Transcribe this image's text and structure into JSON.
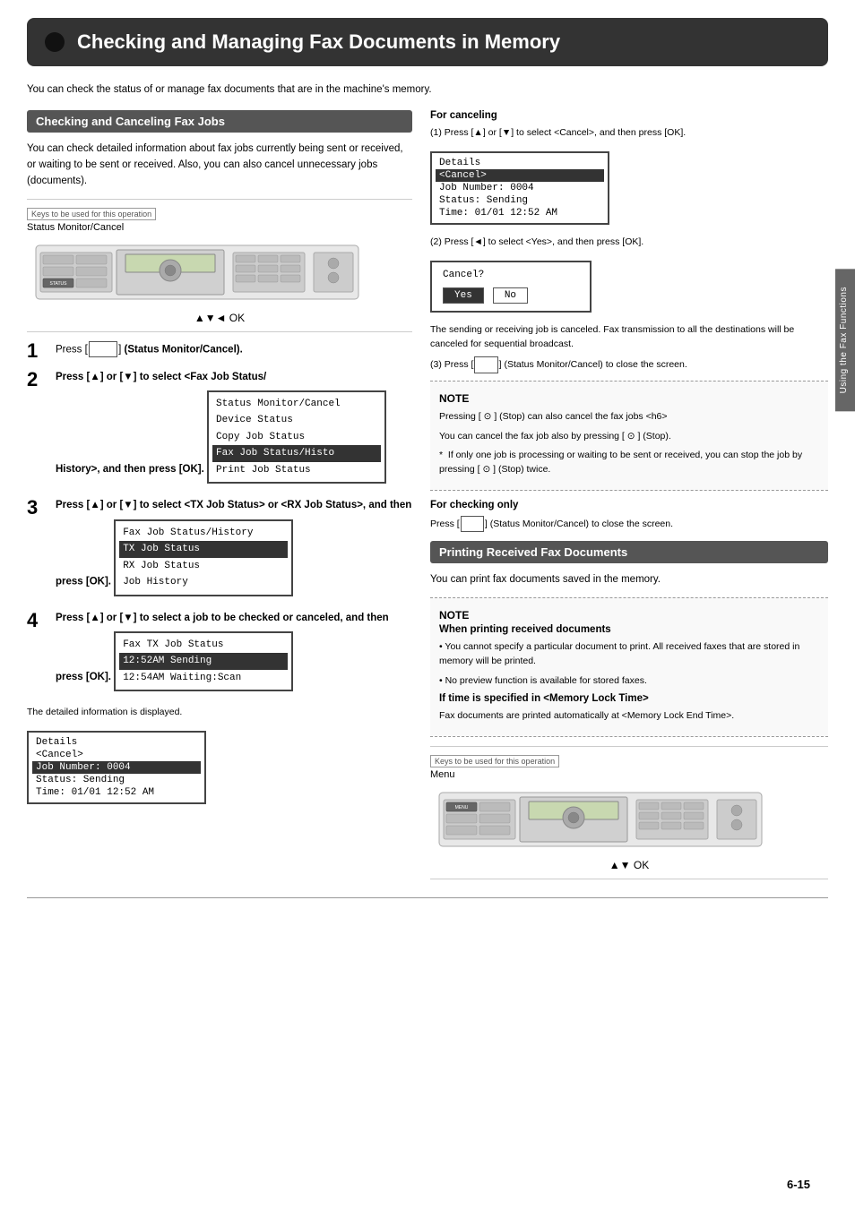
{
  "title": "Checking and Managing Fax Documents in Memory",
  "intro": "You can check the status of or manage fax documents that are in the machine's memory.",
  "left_section": {
    "header": "Checking and Canceling Fax Jobs",
    "description": "You can check detailed information about fax jobs currently being sent or received, or waiting to be sent or received. Also, you can also cancel unnecessary jobs (documents).",
    "keys_label": "Keys to be used for this operation",
    "machine_label": "Status Monitor/Cancel",
    "arrow_row": "▲▼◄ OK",
    "steps": [
      {
        "number": "1",
        "text": "Press [",
        "button_label": "",
        "text_after": " ] (Status Monitor/Cancel)."
      },
      {
        "number": "2",
        "text": "Press [▲] or [▼] to select <Fax Job Status/History>, and then press [OK]."
      },
      {
        "number": "3",
        "text": "Press [▲] or [▼] to select <TX Job Status> or <RX Job Status>, and then press [OK]."
      },
      {
        "number": "4",
        "text": "Press [▲] or [▼] to select a job to be checked or canceled, and then press [OK]."
      }
    ],
    "lcd1": {
      "rows": [
        {
          "text": "Status Monitor/Cancel",
          "highlighted": false
        },
        {
          "text": "Device Status",
          "highlighted": false
        },
        {
          "text": "Copy Job Status",
          "highlighted": false
        },
        {
          "text": "Fax Job Status/Histo",
          "highlighted": true
        },
        {
          "text": "Print Job Status",
          "highlighted": false
        }
      ]
    },
    "lcd2": {
      "rows": [
        {
          "text": "Fax Job Status/History",
          "highlighted": false
        },
        {
          "text": "TX Job Status",
          "highlighted": true
        },
        {
          "text": "RX Job Status",
          "highlighted": false
        },
        {
          "text": "Job History",
          "highlighted": false
        }
      ]
    },
    "lcd3": {
      "rows": [
        {
          "text": "Fax TX Job Status",
          "highlighted": false
        },
        {
          "text": "12:52AM Sending",
          "highlighted": true
        },
        {
          "text": "12:54AM Waiting:Scan",
          "highlighted": false
        }
      ]
    },
    "detailed_info_label": "The detailed information is displayed.",
    "lcd4": {
      "rows": [
        {
          "text": "Details",
          "highlighted": false
        },
        {
          "text": "<Cancel>",
          "highlighted": false
        },
        {
          "text": "Job Number: 0004",
          "highlighted": true
        },
        {
          "text": "Status: Sending",
          "highlighted": false
        },
        {
          "text": "Time: 01/01 12:52 AM",
          "highlighted": false
        }
      ]
    }
  },
  "right_section": {
    "for_canceling_header": "For canceling",
    "for_canceling_step1": "(1) Press [▲] or [▼] to select <Cancel>, and then press [OK].",
    "details_lcd": {
      "rows": [
        {
          "text": "Details",
          "highlighted": false
        },
        {
          "text": "<Cancel>",
          "highlighted": true
        },
        {
          "text": "Job Number: 0004",
          "highlighted": false
        },
        {
          "text": "Status: Sending",
          "highlighted": false
        },
        {
          "text": "Time: 01/01 12:52 AM",
          "highlighted": false
        }
      ]
    },
    "for_canceling_step2": "(2) Press [◄] to select <Yes>, and then press [OK].",
    "cancel_dialog": {
      "title": "Cancel?",
      "yes": "Yes",
      "no": "No"
    },
    "cancel_note1": "The sending or receiving job is canceled. Fax transmission to all the destinations will be canceled for sequential broadcast.",
    "for_canceling_step3_prefix": "(3) Press [",
    "for_canceling_step3_suffix": "] (Status Monitor/Cancel) to close the screen.",
    "note_section": {
      "label": "NOTE",
      "lines": [
        "Pressing [ ⊙ ] (Stop) can also cancel the fax jobs <h6>",
        "You can cancel the fax job also by pressing [ ⊙ ] (Stop).",
        "* If only one job is processing or waiting to be sent or received, you can stop the job by pressing [ ⊙ ] (Stop) twice."
      ]
    },
    "for_checking_header": "For checking only",
    "for_checking_text": "Press [      ] (Status Monitor/Cancel) to close the screen.",
    "printing_header": "Printing Received Fax Documents",
    "printing_intro": "You can print fax documents saved in the memory.",
    "printing_note": {
      "label": "NOTE",
      "when_printing_header": "When printing received documents",
      "when_printing_bullets": [
        "You cannot specify a particular document to print. All received faxes that are stored in memory will be printed.",
        "No preview function is available for stored faxes."
      ],
      "if_time_header": "If time is specified in <Memory Lock Time>",
      "if_time_text": "Fax documents are printed automatically at <Memory Lock End Time>."
    },
    "keys_label": "Keys to be used for this operation",
    "machine_label": "Menu",
    "arrow_row_printing": "▲▼ OK"
  },
  "side_tab": "Using the Fax Functions",
  "page_number": "6-15"
}
